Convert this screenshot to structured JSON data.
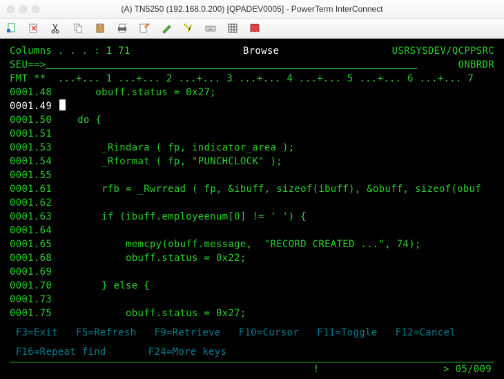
{
  "window": {
    "title": "(A) TN5250 (192.168.0.200) [QPADEV0005] - PowerTerm InterConnect"
  },
  "toolbar": {
    "icons": [
      "new-doc",
      "disconnect",
      "cut",
      "copy",
      "paste",
      "print",
      "edit",
      "brush",
      "tools",
      "keyboard",
      "grid",
      "book"
    ]
  },
  "header": {
    "columns_label": "Columns . . . :    1  71",
    "mode": "Browse",
    "lib_file": "USRSYSDEV/QCPPSRC",
    "seu_label": "SEU==>",
    "member": "ONBRDR",
    "fmt_label": "FMT **",
    "ruler": "  ...+... 1 ...+... 2 ...+... 3 ...+... 4 ...+... 5 ...+... 6 ...+... 7"
  },
  "lines": [
    {
      "n": "0001.48",
      "hl": false,
      "t": "      obuff.status = 0x27;"
    },
    {
      "n": "0001.49",
      "hl": true,
      "t": ""
    },
    {
      "n": "0001.50",
      "hl": false,
      "t": "   do {"
    },
    {
      "n": "0001.51",
      "hl": false,
      "t": ""
    },
    {
      "n": "0001.53",
      "hl": false,
      "t": "       _Rindara ( fp, indicator_area );"
    },
    {
      "n": "0001.54",
      "hl": false,
      "t": "       _Rformat ( fp, \"PUNCHCLOCK\" );"
    },
    {
      "n": "0001.55",
      "hl": false,
      "t": ""
    },
    {
      "n": "0001.61",
      "hl": false,
      "t": "       rfb = _Rwrread ( fp, &ibuff, sizeof(ibuff), &obuff, sizeof(obuf"
    },
    {
      "n": "0001.62",
      "hl": false,
      "t": ""
    },
    {
      "n": "0001.63",
      "hl": false,
      "t": "       if (ibuff.employeenum[0] != ' ') {"
    },
    {
      "n": "0001.64",
      "hl": false,
      "t": ""
    },
    {
      "n": "0001.65",
      "hl": false,
      "t": "           memcpy(obuff.message,  \"RECORD CREATED ...\", 74);"
    },
    {
      "n": "0001.68",
      "hl": false,
      "t": "           obuff.status = 0x22;"
    },
    {
      "n": "0001.69",
      "hl": false,
      "t": ""
    },
    {
      "n": "0001.70",
      "hl": false,
      "t": "       } else {"
    },
    {
      "n": "0001.73",
      "hl": false,
      "t": ""
    },
    {
      "n": "0001.75",
      "hl": false,
      "t": "           obuff.status = 0x27;"
    }
  ],
  "fkeys": {
    "row1": " F3=Exit   F5=Refresh   F9=Retrieve   F10=Cursor   F11=Toggle   F12=Cancel",
    "row2": " F16=Repeat find       F24=More keys"
  },
  "status": {
    "bang": "!",
    "pos": ">   05/009"
  }
}
